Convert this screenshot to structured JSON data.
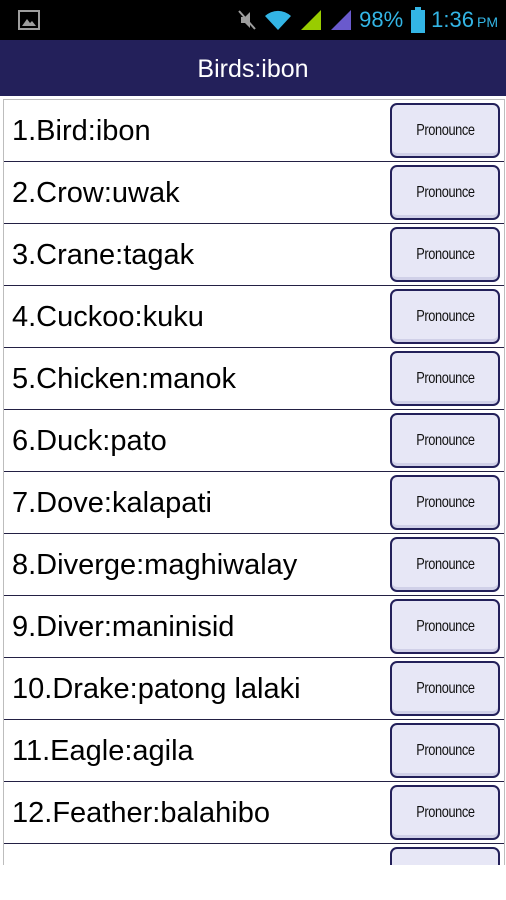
{
  "status_bar": {
    "battery": "98%",
    "time": "1:36",
    "ampm": "PM",
    "icons": [
      "image-notification-icon",
      "mute-icon",
      "wifi-icon",
      "signal-icon",
      "signal-icon",
      "battery-icon"
    ]
  },
  "header": {
    "title": "Birds:ibon"
  },
  "button_label": "Pronounce",
  "items": [
    {
      "label": "1.Bird:ibon"
    },
    {
      "label": "2.Crow:uwak"
    },
    {
      "label": "3.Crane:tagak"
    },
    {
      "label": "4.Cuckoo:kuku"
    },
    {
      "label": "5.Chicken:manok"
    },
    {
      "label": "6.Duck:pato"
    },
    {
      "label": "7.Dove:kalapati"
    },
    {
      "label": "8.Diverge:maghiwalay"
    },
    {
      "label": "9.Diver:maninisid"
    },
    {
      "label": "10.Drake:patong lalaki"
    },
    {
      "label": "11.Eagle:agila"
    },
    {
      "label": "12.Feather:balahibo"
    },
    {
      "label": ""
    }
  ],
  "colors": {
    "status_bar_bg": "#000000",
    "status_icons": "#33b5e5",
    "title_bar_bg": "#23205a",
    "button_bg": "#e7e7f6",
    "button_border": "#23205a"
  }
}
